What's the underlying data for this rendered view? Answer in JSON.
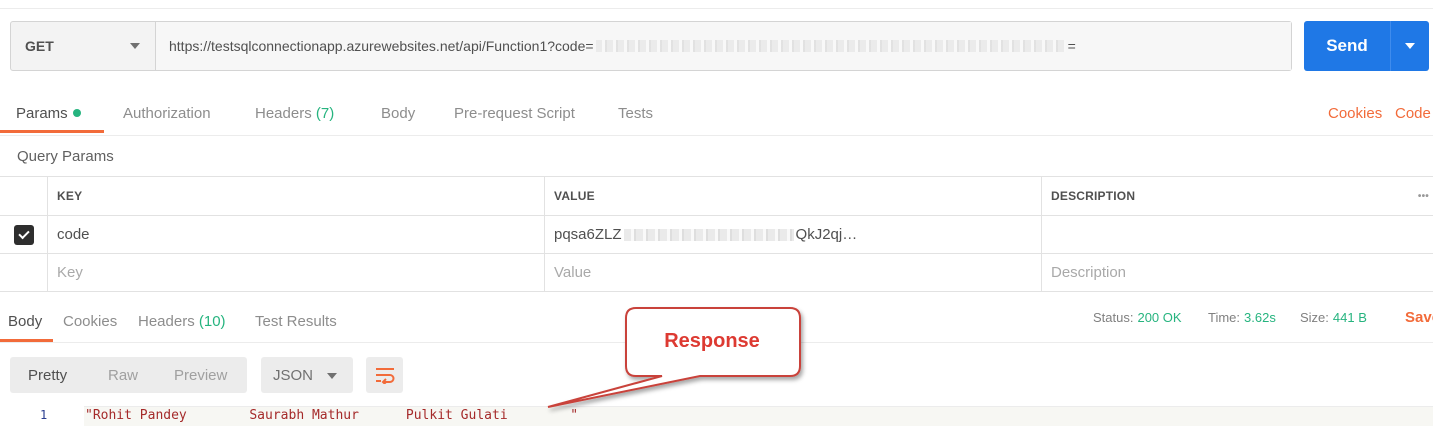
{
  "request": {
    "method": "GET",
    "url_prefix": "https://testsqlconnectionapp.azurewebsites.net/api/Function1?code=",
    "url_suffix": "=",
    "send_label": "Send"
  },
  "request_tabs": {
    "params": "Params",
    "authorization": "Authorization",
    "headers": "Headers",
    "headers_count": "(7)",
    "body": "Body",
    "prerequest": "Pre-request Script",
    "tests": "Tests"
  },
  "links": {
    "cookies": "Cookies",
    "code": "Code"
  },
  "query_params": {
    "title": "Query Params",
    "columns": [
      "KEY",
      "VALUE",
      "DESCRIPTION"
    ],
    "rows": [
      {
        "key": "code",
        "value_start": "pqsa6ZLZ",
        "value_end": "QkJ2qj…"
      }
    ],
    "placeholder": {
      "key": "Key",
      "value": "Value",
      "description": "Description"
    }
  },
  "response_tabs": {
    "body": "Body",
    "cookies": "Cookies",
    "headers": "Headers",
    "headers_count": "(10)",
    "test_results": "Test Results"
  },
  "status": {
    "status_label": "Status:",
    "status_value": "200 OK",
    "time_label": "Time:",
    "time_value": "3.62s",
    "size_label": "Size:",
    "size_value": "441 B",
    "save": "Save"
  },
  "body_toolbar": {
    "pretty": "Pretty",
    "raw": "Raw",
    "preview": "Preview",
    "format": "JSON"
  },
  "response_body": {
    "line_number": "1",
    "content": "\"Rohit Pandey        Saurabh Mathur      Pulkit Gulati        \""
  },
  "annotation": {
    "label": "Response"
  },
  "colors": {
    "accent": "#f26b3a",
    "send": "#1f78e6",
    "success": "#26b47f",
    "callout": "#dd3a32"
  }
}
